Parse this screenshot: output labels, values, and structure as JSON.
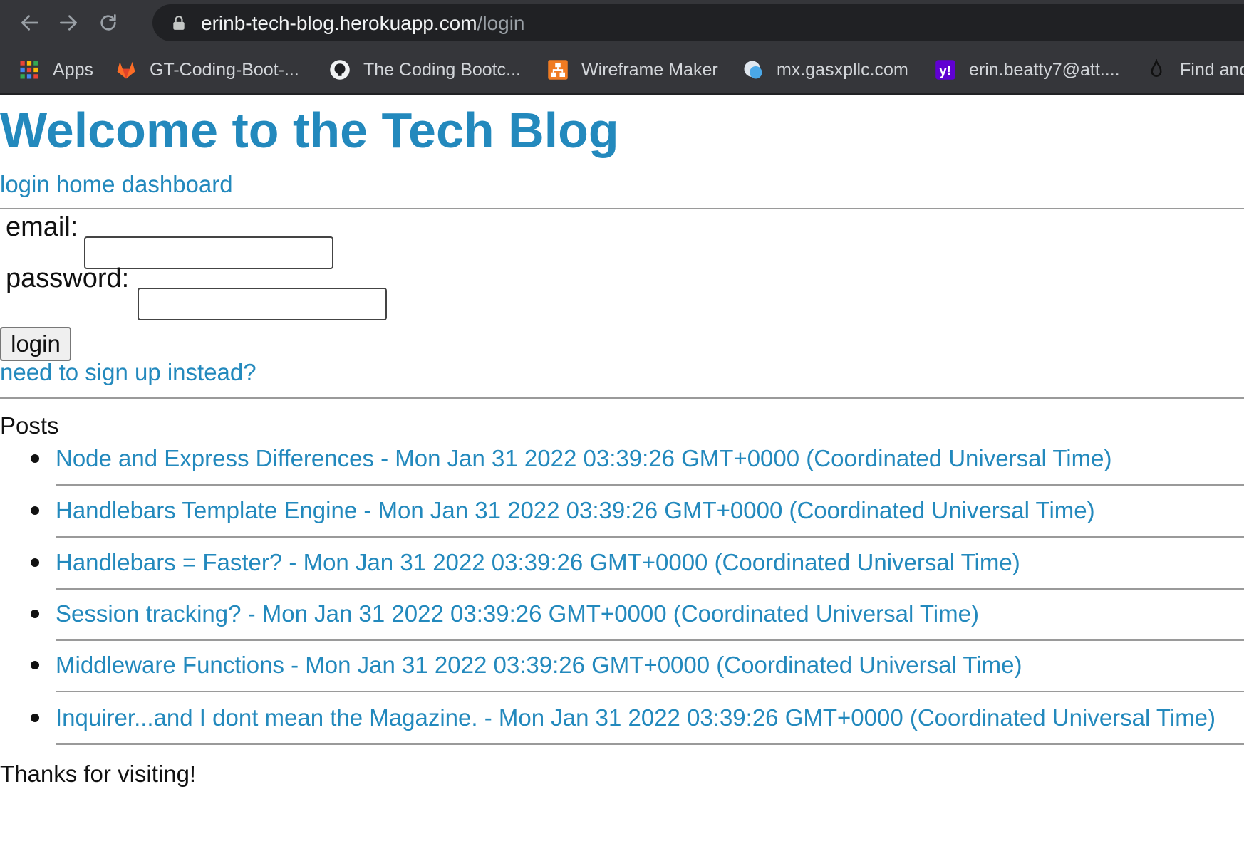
{
  "browser": {
    "url_host": "erinb-tech-blog.herokuapp.com",
    "url_path": "/login",
    "bookmarks": [
      {
        "label": "Apps",
        "icon": "apps-grid-icon"
      },
      {
        "label": "GT-Coding-Boot-...",
        "icon": "gitlab-icon"
      },
      {
        "label": "The Coding Bootc...",
        "icon": "github-icon"
      },
      {
        "label": "Wireframe Maker",
        "icon": "wireframe-icon"
      },
      {
        "label": "mx.gasxpllc.com",
        "icon": "globe-icon"
      },
      {
        "label": "erin.beatty7@att....",
        "icon": "yahoo-icon"
      },
      {
        "label": "Find and",
        "icon": "flame-icon"
      }
    ]
  },
  "header": {
    "title": "Welcome to the Tech Blog",
    "nav": [
      "login",
      "home",
      "dashboard"
    ]
  },
  "login_form": {
    "email_label": "email:",
    "email_value": "",
    "password_label": "password:",
    "password_value": "",
    "submit_label": "login",
    "signup_link": "need to sign up instead?"
  },
  "posts": {
    "heading": "Posts",
    "items": [
      "Node and Express Differences - Mon Jan 31 2022 03:39:26 GMT+0000 (Coordinated Universal Time)",
      "Handlebars Template Engine - Mon Jan 31 2022 03:39:26 GMT+0000 (Coordinated Universal Time)",
      "Handlebars = Faster? - Mon Jan 31 2022 03:39:26 GMT+0000 (Coordinated Universal Time)",
      "Session tracking? - Mon Jan 31 2022 03:39:26 GMT+0000 (Coordinated Universal Time)",
      "Middleware Functions - Mon Jan 31 2022 03:39:26 GMT+0000 (Coordinated Universal Time)",
      "Inquirer...and I dont mean the Magazine. - Mon Jan 31 2022 03:39:26 GMT+0000 (Coordinated Universal Time)"
    ]
  },
  "footer": {
    "text": "Thanks for visiting!"
  },
  "colors": {
    "link": "#2389bd",
    "chrome": "#35363a",
    "omnibox": "#202124"
  }
}
